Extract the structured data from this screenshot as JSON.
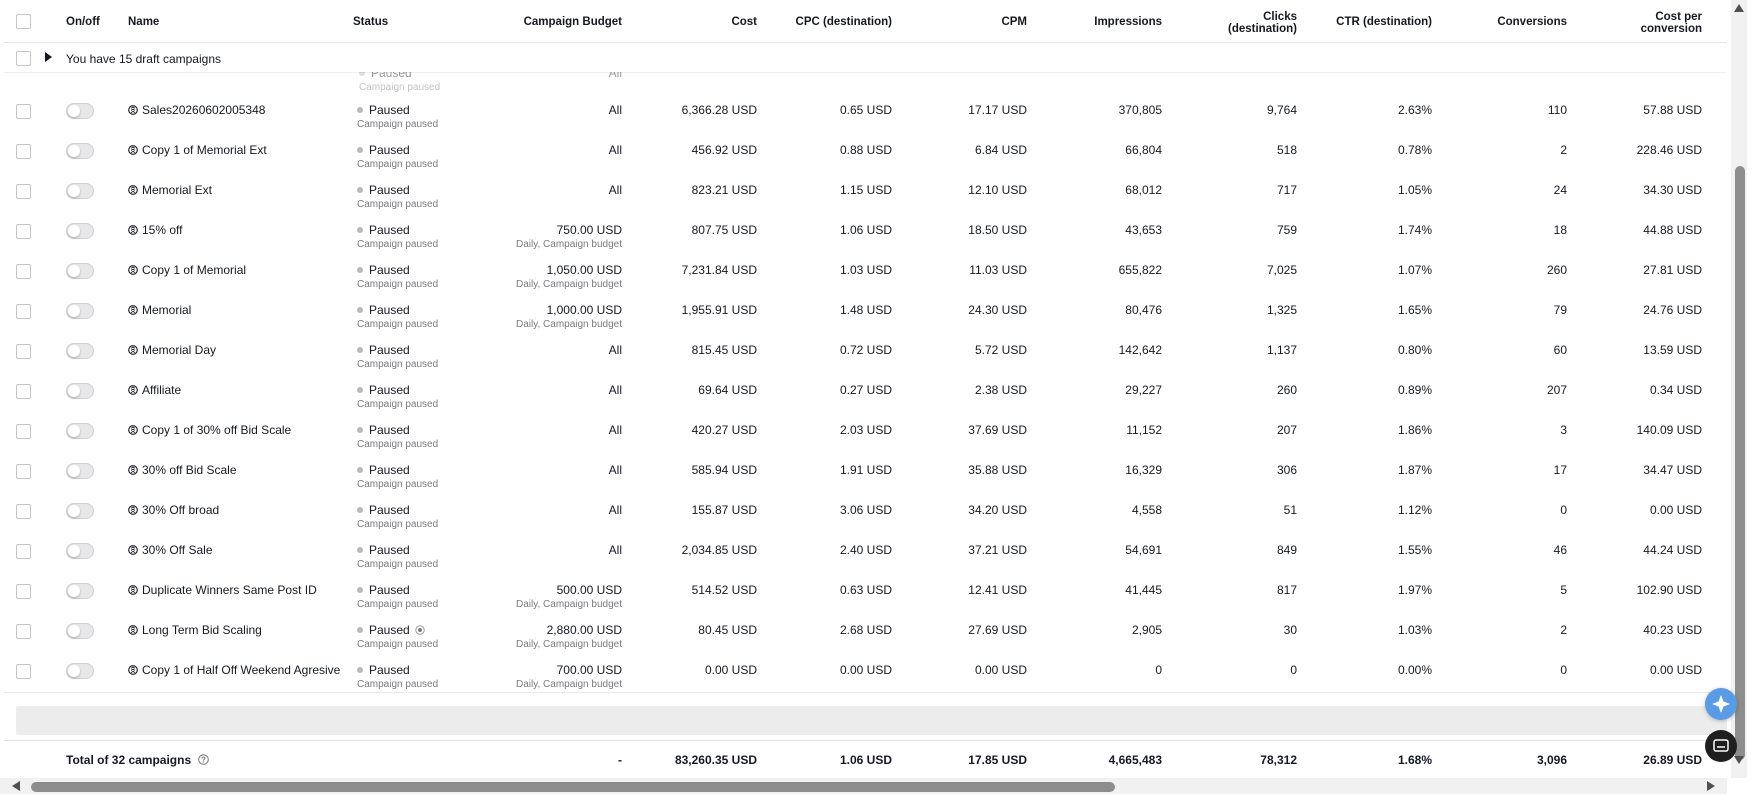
{
  "header": {
    "on_off": "On/off",
    "name": "Name",
    "status": "Status",
    "campaign_budget": "Campaign Budget",
    "cost": "Cost",
    "cpc": "CPC (destination)",
    "cpm": "CPM",
    "impressions": "Impressions",
    "clicks_line1": "Clicks",
    "clicks_line2": "(destination)",
    "ctr": "CTR (destination)",
    "conversions": "Conversions",
    "cost_per_conv_line1": "Cost per",
    "cost_per_conv_line2": "conversion"
  },
  "draft_banner": "You have 15 draft campaigns",
  "partial_row": {
    "status": "Paused",
    "sub": "Campaign paused",
    "budget": "All"
  },
  "rows": [
    {
      "name": "Sales20260602005348",
      "status": "Paused",
      "status_sub": "Campaign paused",
      "budget": "All",
      "budget_sub": "",
      "cost": "6,366.28 USD",
      "cpc": "0.65 USD",
      "cpm": "17.17 USD",
      "impressions": "370,805",
      "clicks": "9,764",
      "ctr": "2.63%",
      "conversions": "110",
      "cost_per_conversion": "57.88 USD"
    },
    {
      "name": "Copy 1 of Memorial Ext",
      "status": "Paused",
      "status_sub": "Campaign paused",
      "budget": "All",
      "budget_sub": "",
      "cost": "456.92 USD",
      "cpc": "0.88 USD",
      "cpm": "6.84 USD",
      "impressions": "66,804",
      "clicks": "518",
      "ctr": "0.78%",
      "conversions": "2",
      "cost_per_conversion": "228.46 USD"
    },
    {
      "name": "Memorial Ext",
      "status": "Paused",
      "status_sub": "Campaign paused",
      "budget": "All",
      "budget_sub": "",
      "cost": "823.21 USD",
      "cpc": "1.15 USD",
      "cpm": "12.10 USD",
      "impressions": "68,012",
      "clicks": "717",
      "ctr": "1.05%",
      "conversions": "24",
      "cost_per_conversion": "34.30 USD"
    },
    {
      "name": "15% off",
      "status": "Paused",
      "status_sub": "Campaign paused",
      "budget": "750.00 USD",
      "budget_sub": "Daily, Campaign budget",
      "cost": "807.75 USD",
      "cpc": "1.06 USD",
      "cpm": "18.50 USD",
      "impressions": "43,653",
      "clicks": "759",
      "ctr": "1.74%",
      "conversions": "18",
      "cost_per_conversion": "44.88 USD"
    },
    {
      "name": "Copy 1 of Memorial",
      "status": "Paused",
      "status_sub": "Campaign paused",
      "budget": "1,050.00 USD",
      "budget_sub": "Daily, Campaign budget",
      "cost": "7,231.84 USD",
      "cpc": "1.03 USD",
      "cpm": "11.03 USD",
      "impressions": "655,822",
      "clicks": "7,025",
      "ctr": "1.07%",
      "conversions": "260",
      "cost_per_conversion": "27.81 USD"
    },
    {
      "name": "Memorial",
      "status": "Paused",
      "status_sub": "Campaign paused",
      "budget": "1,000.00 USD",
      "budget_sub": "Daily, Campaign budget",
      "cost": "1,955.91 USD",
      "cpc": "1.48 USD",
      "cpm": "24.30 USD",
      "impressions": "80,476",
      "clicks": "1,325",
      "ctr": "1.65%",
      "conversions": "79",
      "cost_per_conversion": "24.76 USD"
    },
    {
      "name": "Memorial Day",
      "status": "Paused",
      "status_sub": "Campaign paused",
      "budget": "All",
      "budget_sub": "",
      "cost": "815.45 USD",
      "cpc": "0.72 USD",
      "cpm": "5.72 USD",
      "impressions": "142,642",
      "clicks": "1,137",
      "ctr": "0.80%",
      "conversions": "60",
      "cost_per_conversion": "13.59 USD"
    },
    {
      "name": "Affiliate",
      "status": "Paused",
      "status_sub": "Campaign paused",
      "budget": "All",
      "budget_sub": "",
      "cost": "69.64 USD",
      "cpc": "0.27 USD",
      "cpm": "2.38 USD",
      "impressions": "29,227",
      "clicks": "260",
      "ctr": "0.89%",
      "conversions": "207",
      "cost_per_conversion": "0.34 USD"
    },
    {
      "name": "Copy 1 of 30% off Bid Scale",
      "status": "Paused",
      "status_sub": "Campaign paused",
      "budget": "All",
      "budget_sub": "",
      "cost": "420.27 USD",
      "cpc": "2.03 USD",
      "cpm": "37.69 USD",
      "impressions": "11,152",
      "clicks": "207",
      "ctr": "1.86%",
      "conversions": "3",
      "cost_per_conversion": "140.09 USD"
    },
    {
      "name": "30% off Bid Scale",
      "status": "Paused",
      "status_sub": "Campaign paused",
      "budget": "All",
      "budget_sub": "",
      "cost": "585.94 USD",
      "cpc": "1.91 USD",
      "cpm": "35.88 USD",
      "impressions": "16,329",
      "clicks": "306",
      "ctr": "1.87%",
      "conversions": "17",
      "cost_per_conversion": "34.47 USD"
    },
    {
      "name": "30% Off broad",
      "status": "Paused",
      "status_sub": "Campaign paused",
      "budget": "All",
      "budget_sub": "",
      "cost": "155.87 USD",
      "cpc": "3.06 USD",
      "cpm": "34.20 USD",
      "impressions": "4,558",
      "clicks": "51",
      "ctr": "1.12%",
      "conversions": "0",
      "cost_per_conversion": "0.00 USD"
    },
    {
      "name": "30% Off Sale",
      "status": "Paused",
      "status_sub": "Campaign paused",
      "budget": "All",
      "budget_sub": "",
      "cost": "2,034.85 USD",
      "cpc": "2.40 USD",
      "cpm": "37.21 USD",
      "impressions": "54,691",
      "clicks": "849",
      "ctr": "1.55%",
      "conversions": "46",
      "cost_per_conversion": "44.24 USD"
    },
    {
      "name": "Duplicate Winners Same Post ID",
      "status": "Paused",
      "status_sub": "Campaign paused",
      "budget": "500.00 USD",
      "budget_sub": "Daily, Campaign budget",
      "cost": "514.52 USD",
      "cpc": "0.63 USD",
      "cpm": "12.41 USD",
      "impressions": "41,445",
      "clicks": "817",
      "ctr": "1.97%",
      "conversions": "5",
      "cost_per_conversion": "102.90 USD"
    },
    {
      "name": "Long Term Bid Scaling",
      "status": "Paused",
      "status_sub": "Campaign paused",
      "budget": "2,880.00 USD",
      "budget_sub": "Daily, Campaign budget",
      "cost": "80.45 USD",
      "cpc": "2.68 USD",
      "cpm": "27.69 USD",
      "impressions": "2,905",
      "clicks": "30",
      "ctr": "1.03%",
      "conversions": "2",
      "cost_per_conversion": "40.23 USD"
    },
    {
      "name": "Copy 1 of Half Off Weekend Agresive",
      "status": "Paused",
      "status_sub": "Campaign paused",
      "budget": "700.00 USD",
      "budget_sub": "Daily, Campaign budget",
      "cost": "0.00 USD",
      "cpc": "0.00 USD",
      "cpm": "0.00 USD",
      "impressions": "0",
      "clicks": "0",
      "ctr": "0.00%",
      "conversions": "0",
      "cost_per_conversion": "0.00 USD"
    }
  ],
  "total": {
    "label": "Total of 32 campaigns",
    "budget": "-",
    "cost": "83,260.35 USD",
    "cpc": "1.06 USD",
    "cpm": "17.85 USD",
    "impressions": "4,665,483",
    "clicks": "78,312",
    "ctr": "1.68%",
    "conversions": "3,096",
    "cost_per_conversion": "26.89 USD"
  },
  "icons": {
    "campaign": "campaign-type-icon",
    "info": "info-circle-icon",
    "assistant": "sparkle-icon",
    "chat": "chat-icon"
  },
  "colors": {
    "status_dot": "#b9b9bd",
    "accent_fab": "#4a90e2",
    "scroll_thumb": "#8d8d8d"
  }
}
